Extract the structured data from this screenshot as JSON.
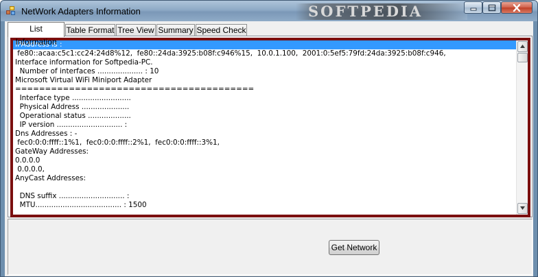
{
  "window": {
    "title": "NetWork Adapters Information",
    "watermark": "SOFTPEDIA",
    "icon": "network-adapter-app-icon",
    "controls": {
      "minimize_icon": "minimize-icon",
      "maximize_icon": "maximize-icon",
      "close_icon": "close-icon"
    }
  },
  "tabs": [
    {
      "label": "List Information",
      "active": true
    },
    {
      "label": "Table Format"
    },
    {
      "label": "Tree View"
    },
    {
      "label": "Summary"
    },
    {
      "label": "Speed Check"
    }
  ],
  "list": {
    "lines": [
      "IPAddress is :",
      " fe80::acaa:c5c1:cc24:24d8%12,  fe80::24da:3925:b08f:c946%15,  10.0.1.100,  2001:0:5ef5:79fd:24da:3925:b08f:c946,",
      "Interface information for Softpedia-PC.",
      "  Number of interfaces .................... : 10",
      "Microsoft Virtual WiFi Miniport Adapter",
      "========================================",
      "  Interface type ..........................",
      "  Physical Address .....................",
      "  Operational status ...................",
      "  IP version ............................. :",
      "Dns Addresses : -",
      " fec0:0:0:ffff::1%1,  fec0:0:0:ffff::2%1,  fec0:0:0:ffff::3%1,",
      "GateWay Addresses:",
      "0.0.0.0",
      " 0.0.0.0,",
      "AnyCast Addresses:",
      "",
      "  DNS suffix ............................. :",
      "  MTU...................................... : 1500"
    ],
    "selected_index": 0
  },
  "scrollbar": {
    "up_icon": "scroll-up-arrow-icon",
    "down_icon": "scroll-down-arrow-icon"
  },
  "actions": {
    "get_network": "Get Network"
  },
  "colors": {
    "selection": "#3399ff",
    "list_border": "#7b0f0f",
    "titlebar": "#8eaac6"
  }
}
